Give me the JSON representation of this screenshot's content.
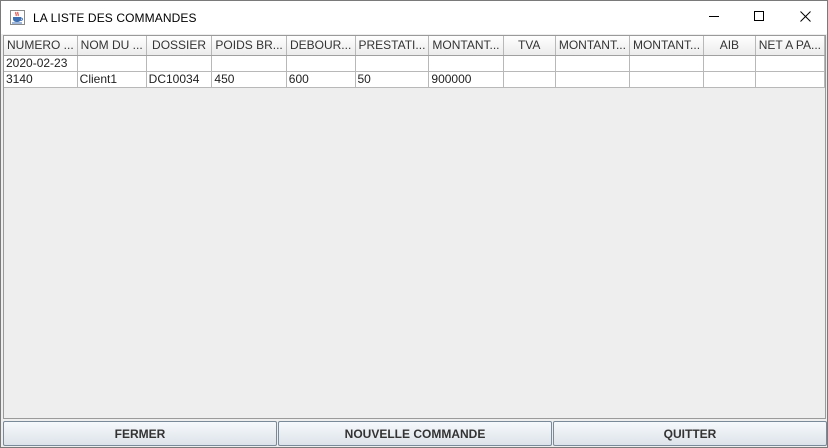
{
  "window": {
    "title": "LA LISTE DES COMMANDES"
  },
  "table": {
    "columns": [
      "NUMERO ...",
      "NOM DU ...",
      "DOSSIER",
      "POIDS BR...",
      "DEBOUR...",
      "PRESTATI...",
      "MONTANT...",
      "TVA",
      "MONTANT...",
      "MONTANT...",
      "AIB",
      "NET A PA..."
    ],
    "rows": [
      [
        "2020-02-23",
        "",
        "",
        "",
        "",
        "",
        "",
        "",
        "",
        "",
        "",
        ""
      ],
      [
        "3140",
        "Client1",
        "DC10034",
        "450",
        "600",
        "50",
        "900000",
        "",
        "",
        "",
        "",
        ""
      ]
    ]
  },
  "buttons": {
    "close_label": "FERMER",
    "new_order_label": "NOUVELLE COMMANDE",
    "quit_label": "QUITTER"
  },
  "icons": {
    "app": "java-cup-icon",
    "minimize": "minimize-icon",
    "maximize": "maximize-icon",
    "close": "close-icon"
  }
}
